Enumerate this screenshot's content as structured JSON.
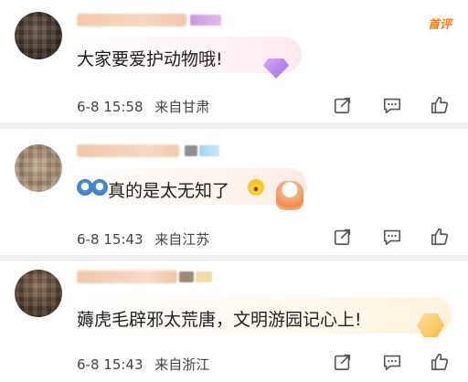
{
  "comments": [
    {
      "author_tag": "首评",
      "text": "大家要爱护动物哦!",
      "date": "6-8",
      "time": "15:58",
      "location": "来自甘肃",
      "decoration_icon": "gem-icon"
    },
    {
      "text": "真的是太无知了",
      "date": "6-8",
      "time": "15:43",
      "location": "来自江苏",
      "decoration_icon": "mascot-icon"
    },
    {
      "text": "薅虎毛辟邪太荒唐，文明游园记心上!",
      "date": "6-8",
      "time": "15:43",
      "location": "来自浙江",
      "decoration_icon": "crown-badge-icon"
    }
  ],
  "actions": [
    "share-icon",
    "comment-icon",
    "like-icon"
  ],
  "colors": {
    "author_tag": "#ff7a1a",
    "separator": "#f1f1f3",
    "text": "#1e1e1e",
    "meta": "#444444"
  }
}
